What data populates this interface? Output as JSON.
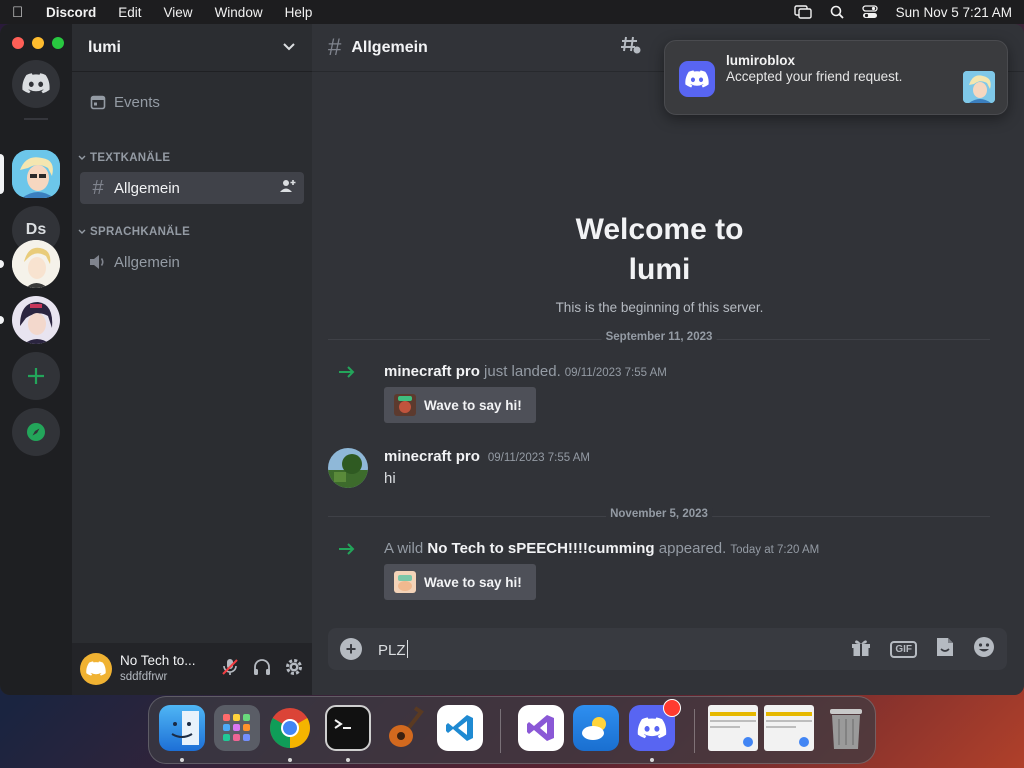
{
  "menubar": {
    "app_name": "Discord",
    "menus": [
      "Edit",
      "View",
      "Window",
      "Help"
    ],
    "clock": "Sun Nov 5  7:21 AM"
  },
  "servers": {
    "initials_server": "Ds"
  },
  "guild": {
    "name": "lumi",
    "events_label": "Events",
    "text_category": "TEXTKANÄLE",
    "voice_category": "SPRACHKANÄLE",
    "text_channel": "Allgemein",
    "voice_channel": "Allgemein"
  },
  "user_panel": {
    "display_name": "No Tech to...",
    "username": "sddfdfrwr"
  },
  "channel_header": {
    "name": "Allgemein"
  },
  "welcome": {
    "title_line1": "Welcome to",
    "title_line2": "lumi",
    "subtitle": "This is the beginning of this server."
  },
  "messages": {
    "divider1": "September 11, 2023",
    "sys1_user": "minecraft pro",
    "sys1_text": " just landed.",
    "sys1_time": "09/11/2023 7:55 AM",
    "wave_label": "Wave to say hi!",
    "msg_author": "minecraft pro",
    "msg_time": "09/11/2023 7:55 AM",
    "msg_text": "hi",
    "divider2": "November 5, 2023",
    "sys2_prefix": "A wild ",
    "sys2_user": "No Tech to sPEECH!!!!cumming",
    "sys2_suffix": " appeared.",
    "sys2_time": "Today at 7:20 AM",
    "wave2_label": "Wave to say hi!"
  },
  "composer": {
    "value": "PLZ",
    "gif_label": "GIF"
  },
  "notification": {
    "title": "lumiroblox",
    "body": "Accepted your friend request."
  },
  "colors": {
    "discord_blurple": "#5865f2",
    "online_green": "#23a55a"
  }
}
